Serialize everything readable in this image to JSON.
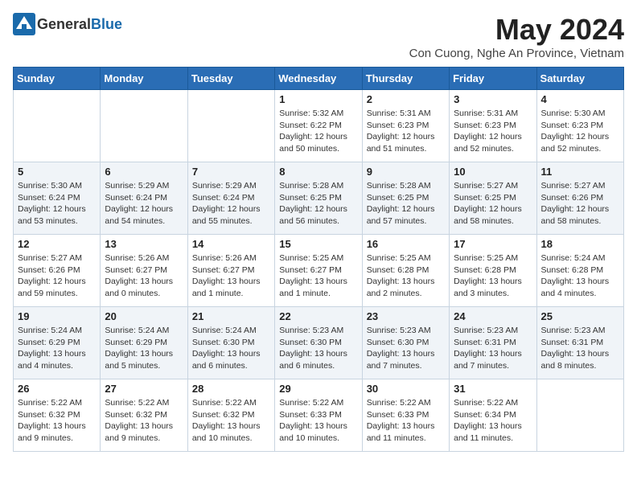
{
  "header": {
    "logo_general": "General",
    "logo_blue": "Blue",
    "month_year": "May 2024",
    "location": "Con Cuong, Nghe An Province, Vietnam"
  },
  "days_of_week": [
    "Sunday",
    "Monday",
    "Tuesday",
    "Wednesday",
    "Thursday",
    "Friday",
    "Saturday"
  ],
  "weeks": [
    [
      {
        "day": "",
        "info": ""
      },
      {
        "day": "",
        "info": ""
      },
      {
        "day": "",
        "info": ""
      },
      {
        "day": "1",
        "info": "Sunrise: 5:32 AM\nSunset: 6:22 PM\nDaylight: 12 hours\nand 50 minutes."
      },
      {
        "day": "2",
        "info": "Sunrise: 5:31 AM\nSunset: 6:23 PM\nDaylight: 12 hours\nand 51 minutes."
      },
      {
        "day": "3",
        "info": "Sunrise: 5:31 AM\nSunset: 6:23 PM\nDaylight: 12 hours\nand 52 minutes."
      },
      {
        "day": "4",
        "info": "Sunrise: 5:30 AM\nSunset: 6:23 PM\nDaylight: 12 hours\nand 52 minutes."
      }
    ],
    [
      {
        "day": "5",
        "info": "Sunrise: 5:30 AM\nSunset: 6:24 PM\nDaylight: 12 hours\nand 53 minutes."
      },
      {
        "day": "6",
        "info": "Sunrise: 5:29 AM\nSunset: 6:24 PM\nDaylight: 12 hours\nand 54 minutes."
      },
      {
        "day": "7",
        "info": "Sunrise: 5:29 AM\nSunset: 6:24 PM\nDaylight: 12 hours\nand 55 minutes."
      },
      {
        "day": "8",
        "info": "Sunrise: 5:28 AM\nSunset: 6:25 PM\nDaylight: 12 hours\nand 56 minutes."
      },
      {
        "day": "9",
        "info": "Sunrise: 5:28 AM\nSunset: 6:25 PM\nDaylight: 12 hours\nand 57 minutes."
      },
      {
        "day": "10",
        "info": "Sunrise: 5:27 AM\nSunset: 6:25 PM\nDaylight: 12 hours\nand 58 minutes."
      },
      {
        "day": "11",
        "info": "Sunrise: 5:27 AM\nSunset: 6:26 PM\nDaylight: 12 hours\nand 58 minutes."
      }
    ],
    [
      {
        "day": "12",
        "info": "Sunrise: 5:27 AM\nSunset: 6:26 PM\nDaylight: 12 hours\nand 59 minutes."
      },
      {
        "day": "13",
        "info": "Sunrise: 5:26 AM\nSunset: 6:27 PM\nDaylight: 13 hours\nand 0 minutes."
      },
      {
        "day": "14",
        "info": "Sunrise: 5:26 AM\nSunset: 6:27 PM\nDaylight: 13 hours\nand 1 minute."
      },
      {
        "day": "15",
        "info": "Sunrise: 5:25 AM\nSunset: 6:27 PM\nDaylight: 13 hours\nand 1 minute."
      },
      {
        "day": "16",
        "info": "Sunrise: 5:25 AM\nSunset: 6:28 PM\nDaylight: 13 hours\nand 2 minutes."
      },
      {
        "day": "17",
        "info": "Sunrise: 5:25 AM\nSunset: 6:28 PM\nDaylight: 13 hours\nand 3 minutes."
      },
      {
        "day": "18",
        "info": "Sunrise: 5:24 AM\nSunset: 6:28 PM\nDaylight: 13 hours\nand 4 minutes."
      }
    ],
    [
      {
        "day": "19",
        "info": "Sunrise: 5:24 AM\nSunset: 6:29 PM\nDaylight: 13 hours\nand 4 minutes."
      },
      {
        "day": "20",
        "info": "Sunrise: 5:24 AM\nSunset: 6:29 PM\nDaylight: 13 hours\nand 5 minutes."
      },
      {
        "day": "21",
        "info": "Sunrise: 5:24 AM\nSunset: 6:30 PM\nDaylight: 13 hours\nand 6 minutes."
      },
      {
        "day": "22",
        "info": "Sunrise: 5:23 AM\nSunset: 6:30 PM\nDaylight: 13 hours\nand 6 minutes."
      },
      {
        "day": "23",
        "info": "Sunrise: 5:23 AM\nSunset: 6:30 PM\nDaylight: 13 hours\nand 7 minutes."
      },
      {
        "day": "24",
        "info": "Sunrise: 5:23 AM\nSunset: 6:31 PM\nDaylight: 13 hours\nand 7 minutes."
      },
      {
        "day": "25",
        "info": "Sunrise: 5:23 AM\nSunset: 6:31 PM\nDaylight: 13 hours\nand 8 minutes."
      }
    ],
    [
      {
        "day": "26",
        "info": "Sunrise: 5:22 AM\nSunset: 6:32 PM\nDaylight: 13 hours\nand 9 minutes."
      },
      {
        "day": "27",
        "info": "Sunrise: 5:22 AM\nSunset: 6:32 PM\nDaylight: 13 hours\nand 9 minutes."
      },
      {
        "day": "28",
        "info": "Sunrise: 5:22 AM\nSunset: 6:32 PM\nDaylight: 13 hours\nand 10 minutes."
      },
      {
        "day": "29",
        "info": "Sunrise: 5:22 AM\nSunset: 6:33 PM\nDaylight: 13 hours\nand 10 minutes."
      },
      {
        "day": "30",
        "info": "Sunrise: 5:22 AM\nSunset: 6:33 PM\nDaylight: 13 hours\nand 11 minutes."
      },
      {
        "day": "31",
        "info": "Sunrise: 5:22 AM\nSunset: 6:34 PM\nDaylight: 13 hours\nand 11 minutes."
      },
      {
        "day": "",
        "info": ""
      }
    ]
  ]
}
